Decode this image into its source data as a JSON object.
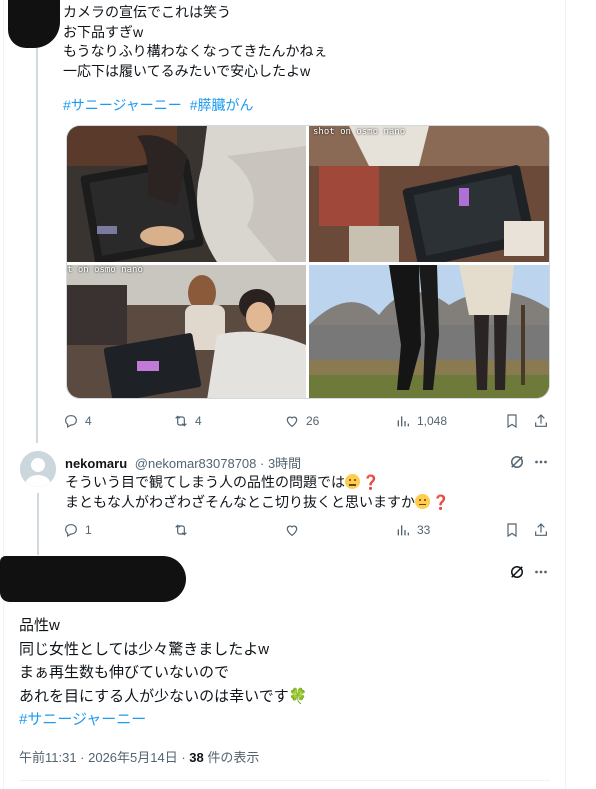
{
  "tweet": {
    "lines": [
      "カメラの宣伝でこれは笑う",
      "お下品すぎw",
      "もうなりふり構わなくなってきたんかねぇ",
      "一応下は履いてるみたいで安心したよw"
    ],
    "hashtags": [
      "#サニージャーニー",
      "#膵臓がん"
    ],
    "media_overlays": [
      "shot on osmo nano",
      "t on osmo nano"
    ],
    "actions": {
      "replies": "4",
      "reposts": "4",
      "likes": "26",
      "views": "1,048"
    }
  },
  "reply": {
    "name": "nekomaru",
    "handle": "@nekomar83078708",
    "time": "· 3時間",
    "line1": "そういう目で観てしまう人の品性の問題では",
    "line2": "まともな人がわざわざそんなとこ切り抜くと思いますか",
    "qmark": "❓",
    "actions": {
      "replies": "1",
      "reposts": "",
      "likes": "",
      "views": "33"
    }
  },
  "main": {
    "lines": [
      "品性w",
      "同じ女性としては少々驚きましたよw",
      "まぁ再生数も伸びていないので",
      "あれを目にする人が少ないのは幸いです"
    ],
    "clover": "🍀",
    "hashtag": "#サニージャーニー",
    "timestamp": "午前11:31 · 2026年5月14日 · ",
    "views_count": "38",
    "views_label": " 件の表示"
  },
  "icons": {
    "reply": "reply-icon",
    "repost": "repost-icon",
    "like": "heart-icon",
    "views": "views-icon",
    "bookmark": "bookmark-icon",
    "share": "share-icon",
    "grok": "grok-icon",
    "more": "more-icon"
  },
  "colors": {
    "link": "#1d9bf0",
    "muted": "#536471",
    "text": "#0f1419",
    "border": "#cfd9de"
  }
}
